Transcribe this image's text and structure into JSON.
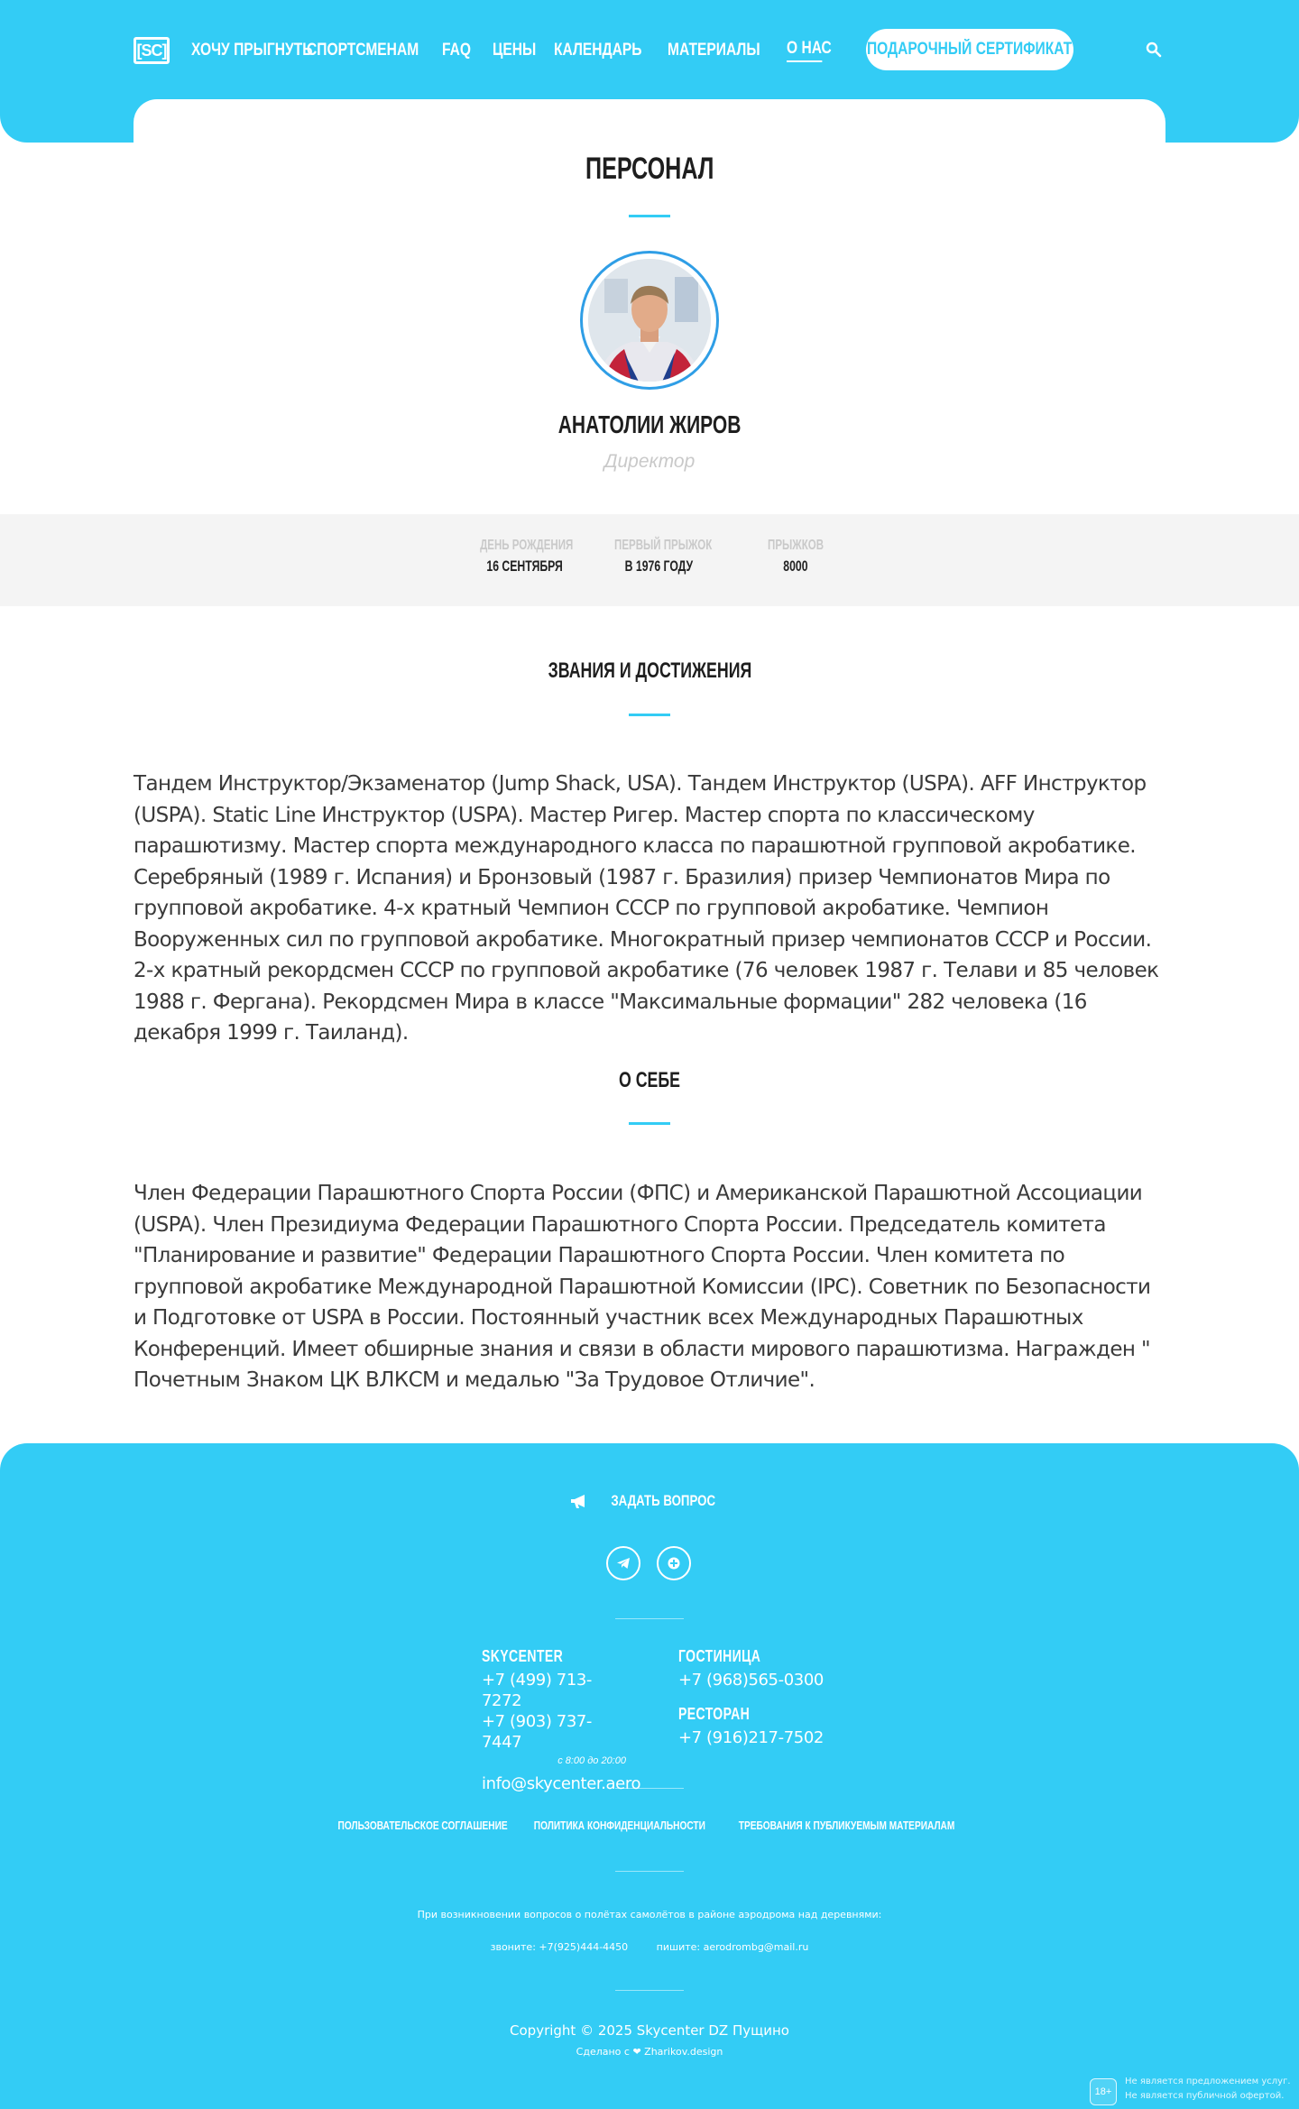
{
  "header": {
    "logo": "[SC]",
    "nav": [
      "Хочу прыгнуть",
      "Спортсменам",
      "FAQ",
      "Цены",
      "Календарь",
      "Материалы",
      "О нас"
    ],
    "gift_button": "Подарочный сертификат",
    "accent_color": "#33ccf5"
  },
  "page": {
    "title": "ПЕРСОНАЛ",
    "name": "АНАТОЛИИ ЖИРОВ",
    "role": "Директор"
  },
  "stats": [
    {
      "label": "День рождения",
      "value": "16 сентября"
    },
    {
      "label": "Первый прыжок",
      "value": "в 1976 году"
    },
    {
      "label": "Прыжков",
      "value": "8000"
    }
  ],
  "sections": {
    "achievements_title": "ЗВАНИЯ И ДОСТИЖЕНИЯ",
    "achievements_text": "Тандем Инструктор/Экзаменатор (Jump Shack, USA). Тандем Инструктор (USPA). AFF Инструктор (USPA). Static Line Инструктор (USPA). Мастер Ригер. Мастер спорта по классическому парашютизму. Мастер спорта международного класса по парашютной групповой акробатике. Серебряный (1989 г. Испания) и Бронзовый (1987 г. Бразилия) призер Чемпионатов Мира по групповой акробатике. 4-х кратный Чемпион СССР по групповой акробатике. Чемпион Вооруженных сил по групповой акробатике. Многократный призер чемпионатов СССР и России. 2-х кратный рекордсмен СССР по групповой акробатике (76 человек 1987 г. Телави и 85 человек 1988 г. Фергана). Рекордсмен Мира в классе \"Максимальные формации\" 282 человека (16 декабря 1999 г. Таиланд).",
    "about_title": "О СЕБЕ",
    "about_text": "Член Федерации Парашютного Спорта России (ФПС) и Американской Парашютной Ассоциации (USPA). Член Президиума Федерации Парашютного Спорта России. Председатель комитета \"Планирование и развитие\" Федерации Парашютного Спорта России. Член комитета по групповой акробатике Международной Парашютной Комиссии (IPC). Советник по Безопасности и Подготовке от USPA в России. Постоянный участник всех Международных Парашютных Конференций. Имеет обширные знания и связи в области мирового парашютизма. Награжден \" Почетным Знаком ЦК ВЛКСМ и медалью \"За Трудовое Отличие\"."
  },
  "footer": {
    "ask": "Задать вопрос",
    "skycenter_head": "SKYCENTER",
    "phone1": "+7 (499) 713-7272",
    "phone2": "+7 (903) 737-7447",
    "hours": "с 8:00 до 20:00",
    "email": "info@skycenter.aero",
    "hotel_head": "ГОСТИНИЦА",
    "hotel_phone": "+7 (968)565-0300",
    "restaurant_head": "РЕСТОРАН",
    "restaurant_phone": "+7 (916)217-7502",
    "legal": [
      "Пользовательское соглашение",
      "Политика конфиденциальности",
      "Требования к публикуемым материалам"
    ],
    "notice": "При возникновении вопросов о полётах самолётов в районе аэродрома над деревнями:",
    "notice_call": "звоните: +7(925)444-4450",
    "notice_write": "пишите: aerodrombg@mail.ru",
    "copyright": "Copyright © 2025 Skycenter DZ Пущино",
    "made_by": "Сделано с ❤ Zharikov.design",
    "age_badge": "18+",
    "offer_line1": "Не является предложением услуг.",
    "offer_line2": "Не является публичной офертой."
  }
}
